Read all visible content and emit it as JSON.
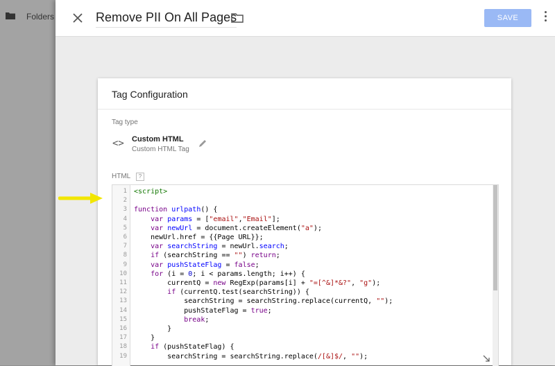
{
  "sidebar": {
    "folders_label": "Folders"
  },
  "header": {
    "title": "Remove PII On All Pages",
    "save_label": "SAVE"
  },
  "card": {
    "title": "Tag Configuration",
    "tag_type_label": "Tag type",
    "tag_type_name": "Custom HTML",
    "tag_type_sub": "Custom HTML Tag",
    "html_label": "HTML",
    "help_glyph": "?"
  },
  "editor": {
    "line_numbers": [
      "1",
      "2",
      "3",
      "4",
      "5",
      "6",
      "7",
      "8",
      "9",
      "10",
      "11",
      "12",
      "13",
      "14",
      "15",
      "16",
      "17",
      "18",
      "19"
    ],
    "lines": [
      "<script>",
      "",
      "function urlpath() {",
      "    var params = [\"email\",\"Email\"];",
      "    var newUrl = document.createElement(\"a\");",
      "    newUrl.href = {{Page URL}};",
      "    var searchString = newUrl.search;",
      "    if (searchString == \"\") return;",
      "    var pushStateFlag = false;",
      "    for (i = 0; i < params.length; i++) {",
      "        currentQ = new RegExp(params[i] + \"=[^&]*&?\", \"g\");",
      "        if (currentQ.test(searchString)) {",
      "            searchString = searchString.replace(currentQ, \"\");",
      "            pushStateFlag = true;",
      "            break;",
      "        }",
      "    }",
      "    if (pushStateFlag) {",
      "        searchString = searchString.replace(/[&]$/, \"\");"
    ]
  },
  "colors": {
    "save_disabled": "#9ab9f5",
    "arrow": "#f2e600",
    "panel_bg": "#ececec"
  }
}
